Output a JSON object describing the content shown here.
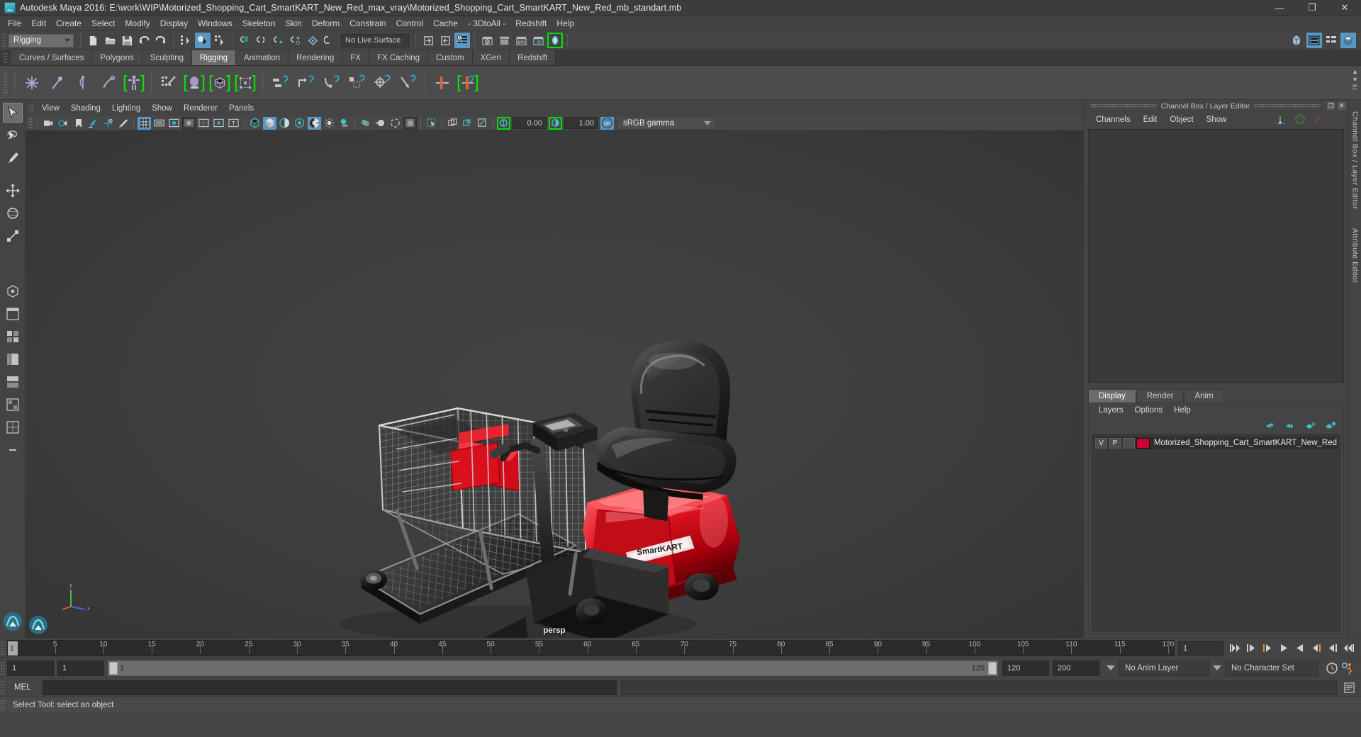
{
  "window": {
    "title": "Autodesk Maya 2016: E:\\work\\WIP\\Motorized_Shopping_Cart_SmartKART_New_Red_max_vray\\Motorized_Shopping_Cart_SmartKART_New_Red_mb_standart.mb",
    "minimize": "—",
    "maximize": "❐",
    "close": "✕"
  },
  "menubar": {
    "items": [
      "File",
      "Edit",
      "Create",
      "Select",
      "Modify",
      "Display",
      "Windows",
      "Skeleton",
      "Skin",
      "Deform",
      "Constrain",
      "Control",
      "Cache",
      "- 3DtoAll -",
      "Redshift",
      "Help"
    ]
  },
  "statusline": {
    "menuset": "Rigging",
    "live_surface": "No Live Surface",
    "icons": [
      "new-scene-icon",
      "open-scene-icon",
      "save-scene-icon",
      "undo-icon",
      "redo-icon",
      "select-by-hierarchy-icon",
      "select-by-object-icon",
      "select-by-component-icon",
      "snap-to-grid-icon",
      "snap-to-curve-icon",
      "snap-to-point-icon",
      "snap-to-projected-center-icon",
      "snap-to-view-plane-icon",
      "make-live-icon",
      "show-hide-editor-icon",
      "show-hide-sidebar-icon",
      "attribute-editor-toggle-icon",
      "render-current-frame-icon",
      "ipr-render-icon",
      "render-settings-icon",
      "redshift-render-icon"
    ],
    "right_icons": [
      "modeling-toolkit-icon",
      "channel-box-toggle-icon",
      "attribute-editor-icon",
      "layer-editor-icon"
    ]
  },
  "shelf": {
    "tabs": [
      "Curves / Surfaces",
      "Polygons",
      "Sculpting",
      "Rigging",
      "Animation",
      "Rendering",
      "FX",
      "FX Caching",
      "Custom",
      "XGen",
      "Redshift"
    ],
    "active_tab": "Rigging",
    "buttons": [
      "create-joint-icon",
      "ik-handle-icon",
      "ik-spline-handle-icon",
      "insert-joint-icon",
      "quick-rig-icon",
      "paint-skin-weights-icon",
      "bind-skin-icon",
      "smooth-bind-icon",
      "interactive-bind-icon",
      "parent-constraint-icon",
      "point-constraint-icon",
      "orient-constraint-icon",
      "scale-constraint-icon",
      "aim-constraint-icon",
      "pole-vector-constraint-icon",
      "lattice-deformer-icon",
      "cluster-deformer-icon"
    ]
  },
  "toolbox": {
    "tools": [
      "select-tool",
      "lasso-select-tool",
      "paint-select-tool",
      "move-tool",
      "rotate-tool",
      "scale-tool",
      "show-manipulator-tool",
      "last-tool-used",
      "single-perspective-layout",
      "four-view-layout",
      "persp-outliner-layout",
      "persp-graph-editor-layout",
      "hypershade-persp-layout",
      "persp-uv-editor-layout",
      "saved-layouts"
    ],
    "active_tool": "select-tool"
  },
  "viewport": {
    "panel_menus": [
      "View",
      "Shading",
      "Lighting",
      "Show",
      "Renderer",
      "Panels"
    ],
    "camera_label": "persp",
    "exposure_value": "0.00",
    "gamma_value": "1.00",
    "color_management": "sRGB gamma",
    "toolbar_icons": [
      "select-camera-icon",
      "lock-camera-icon",
      "camera-bookmark-icon",
      "image-plane-icon",
      "two-d-pan-zoom-icon",
      "grease-pencil-icon",
      "grid-toggle-icon",
      "film-gate-icon",
      "resolution-gate-icon",
      "gate-mask-icon",
      "field-chart-icon",
      "safe-action-icon",
      "safe-title-icon",
      "wireframe-shading-icon",
      "smooth-shade-all-icon",
      "smooth-shade-selected-icon",
      "flat-shade-icon",
      "shaded-wireframe-icon",
      "use-all-lights-icon",
      "shadows-icon",
      "screen-space-ao-icon",
      "motion-blur-icon",
      "multisample-aa-icon",
      "depth-of-field-icon",
      "isolate-select-icon",
      "xray-icon",
      "xray-joints-icon",
      "xray-active-components-icon",
      "exposure-icon",
      "gamma-icon",
      "color-management-toggle-icon"
    ]
  },
  "channel_box": {
    "panel_title": "Channel Box / Layer Editor",
    "menus": [
      "Channels",
      "Edit",
      "Object",
      "Show"
    ],
    "undock_btn": "❐",
    "close_btn": "✕",
    "quick_icons": [
      "axis-gizmo-icon",
      "speedometer-icon",
      "rotate-icon"
    ]
  },
  "layer_editor": {
    "tabs": [
      "Display",
      "Render",
      "Anim"
    ],
    "active_tab": "Display",
    "menus": [
      "Layers",
      "Options",
      "Help"
    ],
    "tool_icons": [
      "move-layer-up-icon",
      "move-layer-down-icon",
      "new-layer-icon",
      "new-layer-from-selected-icon"
    ],
    "layers": [
      {
        "visibility": "V",
        "playback": "P",
        "shading": "",
        "color": "#cc0033",
        "name": "Motorized_Shopping_Cart_SmartKART_New_Red"
      }
    ]
  },
  "side_tabs": [
    "Channel Box / Layer Editor",
    "Attribute Editor"
  ],
  "timeline": {
    "ticks": [
      5,
      10,
      15,
      20,
      25,
      30,
      35,
      40,
      45,
      50,
      55,
      60,
      65,
      70,
      75,
      80,
      85,
      90,
      95,
      100,
      105,
      110,
      115,
      120
    ],
    "current_frame": "1",
    "frame_field": "1",
    "start": 1,
    "end": 120,
    "playback_buttons": [
      "go-to-start-icon",
      "step-back-frame-icon",
      "step-back-key-icon",
      "play-backwards-icon",
      "play-forwards-icon",
      "step-forward-key-icon",
      "step-forward-frame-icon",
      "go-to-end-icon"
    ]
  },
  "range_slider": {
    "anim_start": "1",
    "range_start": "1",
    "bar_start_label": "1",
    "bar_end_label": "120",
    "range_end": "120",
    "anim_end": "200",
    "anim_layer": "No Anim Layer",
    "character_set": "No Character Set",
    "auto_key_icon": "auto-keyframe-icon",
    "anim_prefs_icon": "animation-preferences-icon"
  },
  "command_line": {
    "language": "MEL",
    "input_value": "",
    "output_value": "",
    "script_editor_icon": "script-editor-icon"
  },
  "status_bar": {
    "message": "Select Tool: select an object"
  },
  "colors": {
    "accent_blue": "#5b97c4",
    "green_highlight": "#00e000",
    "layer_red": "#cc0033",
    "orange": "#e08a30",
    "panel_bg": "#444444",
    "viewport_bg": "#3a3a3a"
  }
}
